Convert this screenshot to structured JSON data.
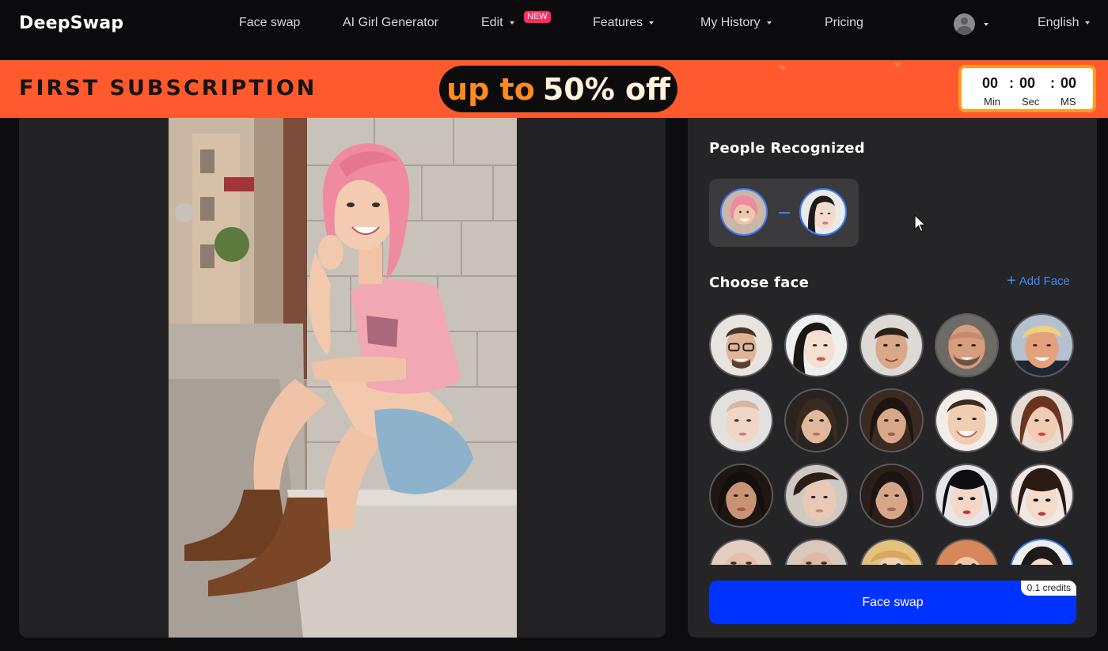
{
  "brand": {
    "logo": "DeepSwap"
  },
  "nav": {
    "items": [
      {
        "label": "Face swap",
        "caret": false
      },
      {
        "label": "AI Girl Generator",
        "caret": false
      },
      {
        "label": "Edit",
        "caret": true,
        "badge": "NEW"
      },
      {
        "label": "Features",
        "caret": true
      },
      {
        "label": "My History",
        "caret": true
      },
      {
        "label": "Pricing",
        "caret": false
      }
    ],
    "language": "English"
  },
  "promo": {
    "title": "FIRST SUBSCRIPTION",
    "offer_a": "up to",
    "offer_b": "50% off",
    "timer": {
      "min": "00",
      "sec": "00",
      "ms": "00",
      "min_label": "Min",
      "sec_label": "Sec",
      "ms_label": "MS",
      "sep": ":"
    }
  },
  "panel": {
    "recognized_title": "People Recognized",
    "choose_title": "Choose face",
    "add_face": "Add Face",
    "swap_button": "Face swap",
    "credits": "0.1 credits"
  },
  "colors": {
    "accent_blue": "#3f7dff",
    "button_blue": "#0033ff",
    "promo_orange": "#ff5a2d",
    "badge_pink": "#ff2b5e"
  },
  "icons": [
    "caret-down-icon",
    "user-avatar-icon",
    "plus-icon",
    "mouse-cursor-icon"
  ]
}
